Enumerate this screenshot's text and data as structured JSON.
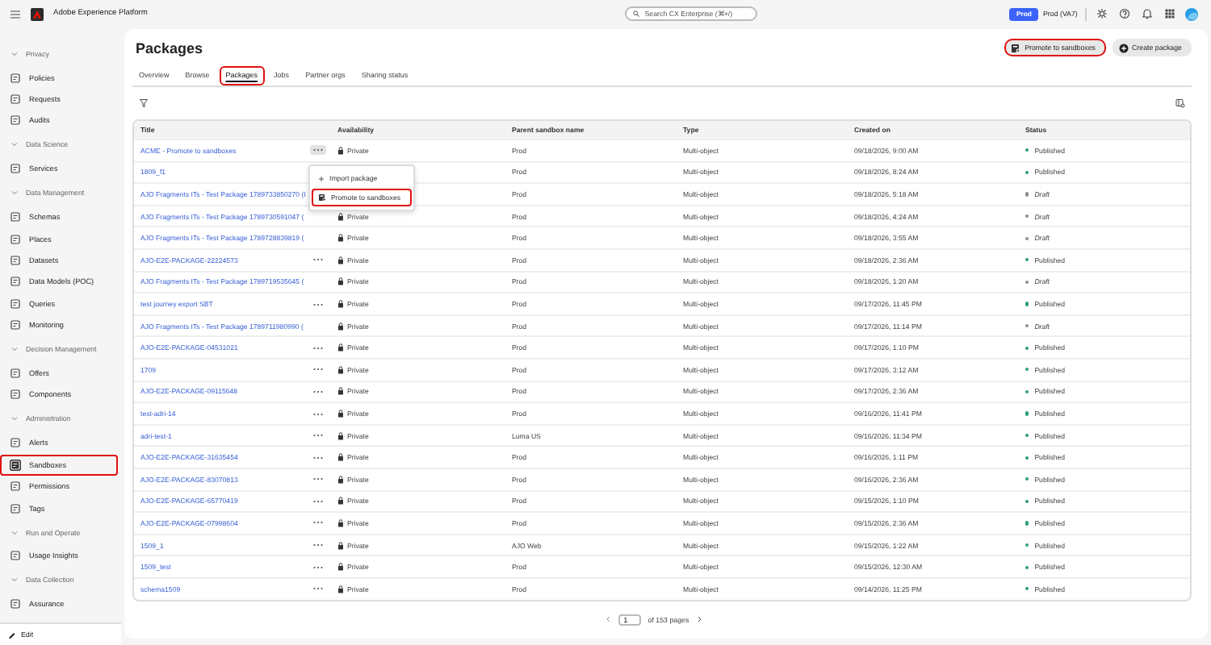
{
  "app": {
    "title": "Adobe Experience Platform"
  },
  "search": {
    "placeholder": "Search CX Enterprise (⌘+/)"
  },
  "sandbox": {
    "badge": "Prod",
    "name": "Prod (VA7)"
  },
  "sidebar": {
    "sections": [
      {
        "heading": "Privacy",
        "items": [
          {
            "label": "Policies",
            "selected": false,
            "highlighted": false
          },
          {
            "label": "Requests",
            "selected": false,
            "highlighted": false
          },
          {
            "label": "Audits",
            "selected": false,
            "highlighted": false
          }
        ]
      },
      {
        "heading": "Data Science",
        "items": [
          {
            "label": "Services",
            "selected": false,
            "highlighted": false
          }
        ]
      },
      {
        "heading": "Data Management",
        "items": [
          {
            "label": "Schemas",
            "selected": false,
            "highlighted": false
          },
          {
            "label": "Places",
            "selected": false,
            "highlighted": false
          },
          {
            "label": "Datasets",
            "selected": false,
            "highlighted": false
          },
          {
            "label": "Data Models (POC)",
            "selected": false,
            "highlighted": false
          },
          {
            "label": "Queries",
            "selected": false,
            "highlighted": false
          },
          {
            "label": "Monitoring",
            "selected": false,
            "highlighted": false
          }
        ]
      },
      {
        "heading": "Decision Management",
        "items": [
          {
            "label": "Offers",
            "selected": false,
            "highlighted": false
          },
          {
            "label": "Components",
            "selected": false,
            "highlighted": false
          }
        ]
      },
      {
        "heading": "Administration",
        "items": [
          {
            "label": "Alerts",
            "selected": false,
            "highlighted": false
          },
          {
            "label": "Sandboxes",
            "selected": true,
            "highlighted": true
          },
          {
            "label": "Permissions",
            "selected": false,
            "highlighted": false
          },
          {
            "label": "Tags",
            "selected": false,
            "highlighted": false
          }
        ]
      },
      {
        "heading": "Run and Operate",
        "items": [
          {
            "label": "Usage Insights",
            "selected": false,
            "highlighted": false
          }
        ]
      },
      {
        "heading": "Data Collection",
        "items": [
          {
            "label": "Assurance",
            "selected": false,
            "highlighted": false
          }
        ]
      }
    ],
    "footer": "Edit"
  },
  "page": {
    "title": "Packages",
    "actions": [
      {
        "label": "Promote to sandboxes",
        "kind": "promote",
        "highlighted": true
      },
      {
        "label": "Create package",
        "kind": "create",
        "highlighted": false
      }
    ],
    "tabs": [
      {
        "label": "Overview",
        "selected": false,
        "highlighted": false
      },
      {
        "label": "Browse",
        "selected": false,
        "highlighted": false
      },
      {
        "label": "Packages",
        "selected": true,
        "highlighted": true
      },
      {
        "label": "Jobs",
        "selected": false,
        "highlighted": false
      },
      {
        "label": "Partner orgs",
        "selected": false,
        "highlighted": false
      },
      {
        "label": "Sharing status",
        "selected": false,
        "highlighted": false
      }
    ]
  },
  "table": {
    "columns": [
      "Title",
      "Availability",
      "Parent sandbox name",
      "Type",
      "Created on",
      "Status"
    ],
    "rows": [
      {
        "title": "ACME - Promote to sandboxes",
        "actions": true,
        "menu_open": true,
        "availability": "Private",
        "parent": "Prod",
        "type": "Multi-object",
        "created": "09/18/2026, 9:00 AM",
        "status": {
          "label": "Published",
          "kind": "published",
          "color": "#2d9d78"
        }
      },
      {
        "title": "1809_f1",
        "actions": false,
        "parent": "Prod",
        "type": "Multi-object",
        "created": "09/18/2026, 8:24 AM",
        "status": {
          "label": "Published",
          "kind": "published",
          "color": "#2d9d78"
        }
      },
      {
        "title": "AJO Fragments ITs - Test Package 1789733850270 (I",
        "actions": false,
        "parent": "Prod",
        "type": "Multi-object",
        "created": "09/18/2026, 5:18 AM",
        "status": {
          "label": "Draft",
          "kind": "draft",
          "color": "#8e8e8e"
        }
      },
      {
        "title": "AJO Fragments ITs - Test Package 1789730591047 (",
        "actions": false,
        "availability": "Private",
        "parent": "Prod",
        "type": "Multi-object",
        "created": "09/18/2026, 4:24 AM",
        "status": {
          "label": "Draft",
          "kind": "draft",
          "color": "#8e8e8e"
        }
      },
      {
        "title": "AJO Fragments ITs - Test Package 1789728839819 (",
        "actions": false,
        "availability": "Private",
        "parent": "Prod",
        "type": "Multi-object",
        "created": "09/18/2026, 3:55 AM",
        "status": {
          "label": "Draft",
          "kind": "draft",
          "color": "#8e8e8e"
        }
      },
      {
        "title": "AJO-E2E-PACKAGE-22224573",
        "actions": true,
        "menu_open": false,
        "availability": "Private",
        "parent": "Prod",
        "type": "Multi-object",
        "created": "09/18/2026, 2:36 AM",
        "status": {
          "label": "Published",
          "kind": "published",
          "color": "#2d9d78"
        }
      },
      {
        "title": "AJO Fragments ITs - Test Package 1789719535645 (",
        "actions": false,
        "availability": "Private",
        "parent": "Prod",
        "type": "Multi-object",
        "created": "09/18/2026, 1:20 AM",
        "status": {
          "label": "Draft",
          "kind": "draft",
          "color": "#8e8e8e"
        }
      },
      {
        "title": "test journey export SBT",
        "actions": true,
        "menu_open": false,
        "availability": "Private",
        "parent": "Prod",
        "type": "Multi-object",
        "created": "09/17/2026, 11:45 PM",
        "status": {
          "label": "Published",
          "kind": "published",
          "color": "#2d9d78"
        }
      },
      {
        "title": "AJO Fragments ITs - Test Package 1789711980990 (",
        "actions": false,
        "availability": "Private",
        "parent": "Prod",
        "type": "Multi-object",
        "created": "09/17/2026, 11:14 PM",
        "status": {
          "label": "Draft",
          "kind": "draft",
          "color": "#8e8e8e"
        }
      },
      {
        "title": "AJO-E2E-PACKAGE-04531021",
        "actions": true,
        "menu_open": false,
        "availability": "Private",
        "parent": "Prod",
        "type": "Multi-object",
        "created": "09/17/2026, 1:10 PM",
        "status": {
          "label": "Published",
          "kind": "published",
          "color": "#2d9d78"
        }
      },
      {
        "title": "1709",
        "actions": true,
        "menu_open": false,
        "availability": "Private",
        "parent": "Prod",
        "type": "Multi-object",
        "created": "09/17/2026, 3:12 AM",
        "status": {
          "label": "Published",
          "kind": "published",
          "color": "#2d9d78"
        }
      },
      {
        "title": "AJO-E2E-PACKAGE-09115648",
        "actions": true,
        "menu_open": false,
        "availability": "Private",
        "parent": "Prod",
        "type": "Multi-object",
        "created": "09/17/2026, 2:36 AM",
        "status": {
          "label": "Published",
          "kind": "published",
          "color": "#2d9d78"
        }
      },
      {
        "title": "test-adri-14",
        "actions": true,
        "menu_open": false,
        "availability": "Private",
        "parent": "Prod",
        "type": "Multi-object",
        "created": "09/16/2026, 11:41 PM",
        "status": {
          "label": "Published",
          "kind": "published",
          "color": "#2d9d78"
        }
      },
      {
        "title": "adri-test-1",
        "actions": true,
        "menu_open": false,
        "availability": "Private",
        "parent": "Luma US",
        "type": "Multi-object",
        "created": "09/16/2026, 11:34 PM",
        "status": {
          "label": "Published",
          "kind": "published",
          "color": "#2d9d78"
        }
      },
      {
        "title": "AJO-E2E-PACKAGE-31635454",
        "actions": true,
        "menu_open": false,
        "availability": "Private",
        "parent": "Prod",
        "type": "Multi-object",
        "created": "09/16/2026, 1:11 PM",
        "status": {
          "label": "Published",
          "kind": "published",
          "color": "#2d9d78"
        }
      },
      {
        "title": "AJO-E2E-PACKAGE-83070813",
        "actions": true,
        "menu_open": false,
        "availability": "Private",
        "parent": "Prod",
        "type": "Multi-object",
        "created": "09/16/2026, 2:36 AM",
        "status": {
          "label": "Published",
          "kind": "published",
          "color": "#2d9d78"
        }
      },
      {
        "title": "AJO-E2E-PACKAGE-65770419",
        "actions": true,
        "menu_open": false,
        "availability": "Private",
        "parent": "Prod",
        "type": "Multi-object",
        "created": "09/15/2026, 1:10 PM",
        "status": {
          "label": "Published",
          "kind": "published",
          "color": "#2d9d78"
        }
      },
      {
        "title": "AJO-E2E-PACKAGE-07998604",
        "actions": true,
        "menu_open": false,
        "availability": "Private",
        "parent": "Prod",
        "type": "Multi-object",
        "created": "09/15/2026, 2:36 AM",
        "status": {
          "label": "Published",
          "kind": "published",
          "color": "#2d9d78"
        }
      },
      {
        "title": "1509_1",
        "actions": true,
        "menu_open": false,
        "availability": "Private",
        "parent": "AJO Web",
        "type": "Multi-object",
        "created": "09/15/2026, 1:22 AM",
        "status": {
          "label": "Published",
          "kind": "published",
          "color": "#2d9d78"
        }
      },
      {
        "title": "1509_test",
        "actions": true,
        "menu_open": false,
        "availability": "Private",
        "parent": "Prod",
        "type": "Multi-object",
        "created": "09/15/2026, 12:30 AM",
        "status": {
          "label": "Published",
          "kind": "published",
          "color": "#2d9d78"
        }
      },
      {
        "title": "schema1509",
        "actions": true,
        "menu_open": false,
        "availability": "Private",
        "parent": "Prod",
        "type": "Multi-object",
        "created": "09/14/2026, 11:25 PM",
        "status": {
          "label": "Published",
          "kind": "published",
          "color": "#2d9d78"
        }
      }
    ]
  },
  "row_menu": {
    "items": [
      {
        "label": "Import package",
        "kind": "import",
        "highlighted": false
      },
      {
        "label": "Promote to sandboxes",
        "kind": "promote",
        "highlighted": true
      }
    ]
  },
  "pagination": {
    "page": "1",
    "total": "of 153 pages"
  }
}
